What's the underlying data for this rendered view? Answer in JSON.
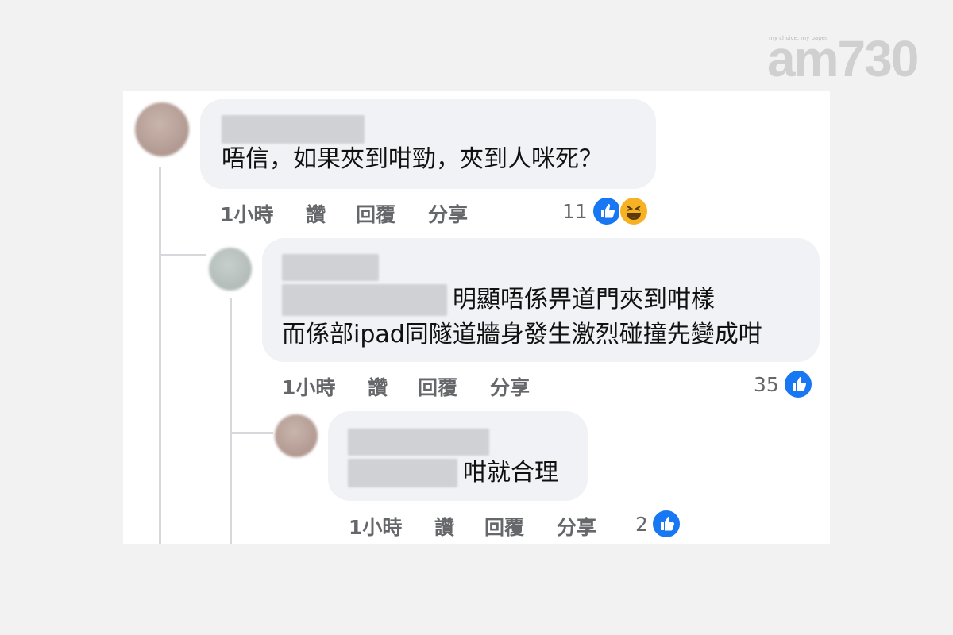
{
  "brand": {
    "tagline": "my choice, my paper",
    "logo_text": "am730"
  },
  "comments": [
    {
      "text_lines": [
        "唔信，如果夾到咁勁，夾到人咪死？"
      ],
      "time": "1小時",
      "like_label": "讚",
      "reply_label": "回覆",
      "share_label": "分享",
      "reaction_count": "11",
      "reactions": [
        "like-icon",
        "haha-icon"
      ]
    },
    {
      "text_lines": [
        "明顯唔係畀道門夾到咁樣",
        "而係部ipad同隧道牆身發生激烈碰撞先變成咁"
      ],
      "time": "1小時",
      "like_label": "讚",
      "reply_label": "回覆",
      "share_label": "分享",
      "reaction_count": "35",
      "reactions": [
        "like-icon"
      ]
    },
    {
      "text_lines": [
        "咁就合理"
      ],
      "time": "1小時",
      "like_label": "讚",
      "reply_label": "回覆",
      "share_label": "分享",
      "reaction_count": "2",
      "reactions": [
        "like-icon"
      ]
    }
  ],
  "colors": {
    "like_blue": "#1877f2",
    "bubble_bg": "#f0f2f5",
    "meta_gray": "#65676b"
  }
}
